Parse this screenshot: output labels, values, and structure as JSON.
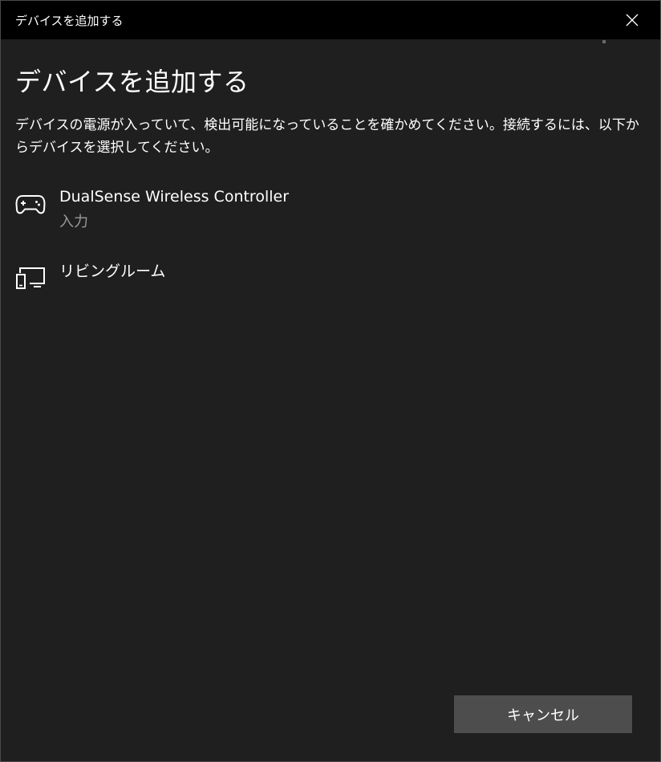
{
  "window": {
    "title": "デバイスを追加する"
  },
  "content": {
    "heading": "デバイスを追加する",
    "description": "デバイスの電源が入っていて、検出可能になっていることを確かめてください。接続するには、以下からデバイスを選択してください。"
  },
  "devices": [
    {
      "name": "DualSense Wireless Controller",
      "type": "入力",
      "icon": "gamepad-icon"
    },
    {
      "name": "リビングルーム",
      "icon": "display-device-icon"
    }
  ],
  "footer": {
    "cancel_label": "キャンセル"
  },
  "colors": {
    "titlebar_bg": "#000000",
    "window_bg": "#1f1f1f",
    "text_primary": "#ffffff",
    "text_secondary": "#9a9a9a",
    "button_bg": "#4d4d4d"
  }
}
